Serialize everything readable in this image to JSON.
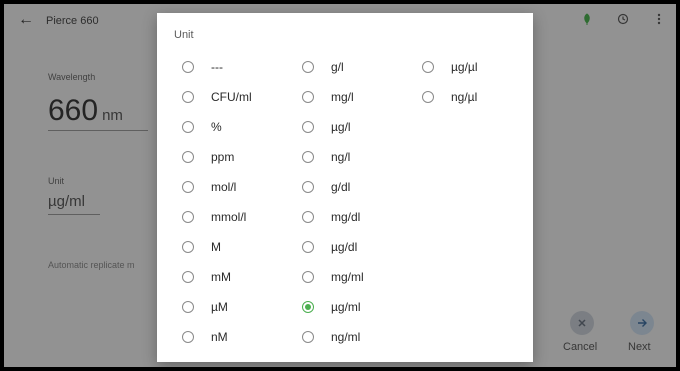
{
  "app": {
    "title": "Pierce 660",
    "back_icon": "←",
    "wavelength_label": "Wavelength",
    "wavelength_value": "660",
    "wavelength_unit": "nm",
    "unit_label": "Unit",
    "unit_value": "µg/ml",
    "automatic_replicate_text": "Automatic replicate m",
    "cancel_label": "Cancel",
    "next_label": "Next"
  },
  "colors": {
    "selected": "#4caf50",
    "scrim": "rgba(0,0,0,0.38)"
  },
  "dialog": {
    "title": "Unit",
    "columns": [
      [
        "---",
        "CFU/ml",
        "%",
        "ppm",
        "mol/l",
        "mmol/l",
        "M",
        "mM",
        "µM",
        "nM"
      ],
      [
        "g/l",
        "mg/l",
        "µg/l",
        "ng/l",
        "g/dl",
        "mg/dl",
        "µg/dl",
        "mg/ml",
        "µg/ml",
        "ng/ml"
      ],
      [
        "µg/µl",
        "ng/µl"
      ]
    ],
    "selected": "µg/ml"
  }
}
